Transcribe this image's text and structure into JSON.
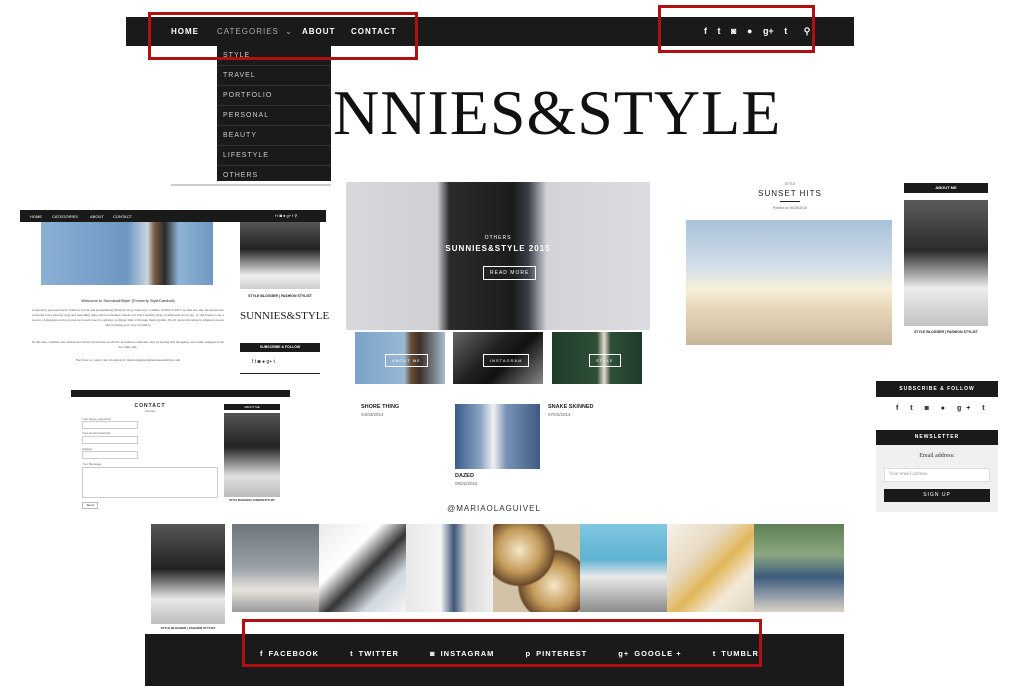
{
  "nav": {
    "home": "HOME",
    "categories": "CATEGORIES",
    "about": "ABOUT",
    "contact": "CONTACT",
    "chevron": "chevron-down-icon"
  },
  "dropdown": [
    "STYLE",
    "TRAVEL",
    "PORTFOLIO",
    "PERSONAL",
    "BEAUTY",
    "LIFESTYLE",
    "OTHERS"
  ],
  "social_icons": [
    "f",
    "t",
    "i",
    "p",
    "g+",
    "t"
  ],
  "logo_text": "NNIES&STYLE",
  "hero": {
    "category": "OTHERS",
    "title": "SUNNIES&STYLE 2015",
    "button": "READ MORE"
  },
  "tiles": [
    "ABOUT ME",
    "INSTAGRAM",
    "STYLE"
  ],
  "posts": [
    {
      "title": "SHORE THING",
      "date": "04/03/2014"
    },
    {
      "title": "SNAKE SKINNED",
      "date": "07/01/2014"
    },
    {
      "title": "DAZED",
      "date": "08/22/2015"
    }
  ],
  "instagram_handle": "@MARIAOLAGUIVEL",
  "right_post": {
    "category": "STYLE",
    "title": "SUNSET HITS",
    "date": "Posted on 05/25/2015"
  },
  "sidebar": {
    "about_title": "ABOUT ME",
    "caption": "STYLE BLOGGER | FASHION STYLIST",
    "subscribe_title": "SUBSCRIBE & FOLLOW",
    "newsletter_title": "NEWSLETTER",
    "email_label": "Email address:",
    "email_placeholder": "Your email address",
    "signup": "SIGN UP"
  },
  "mini_left": {
    "nav": [
      "HOME",
      "CATEGORIES",
      "ABOUT",
      "CONTACT"
    ],
    "welcome": "Welcome to Sunnies&Style! (Formerly StyleCarnival)",
    "para1": "A (mostly) personal style, fashion, travel and (sometimes) lifestyle blog created by Camille in March 2015. In this site she chronicles her personal fears (mostly not) and matching lines and non-fashion trends as I don't usually shop on high-end stores (ie, 1) and hopes to be a source of inspiration that everyone doesn't need to splurge on things that will make them stylish. It's all about investing in timeless pieces and working your way around it.",
    "para2": "In this site, Camille also shares her travel adventures, portfolio in fashion editorials, tips in styling and shopping, and some snippets from her daily life.",
    "para3": "Feel free to contact me via email at: mariaolaguivel@sunniesandstyle.com",
    "logo": "SUNNIES&STYLE",
    "caption": "STYLE BLOGGER | FASHION STYLIST",
    "subscribe": "SUBSCRIBE & FOLLOW"
  },
  "contact_mini": {
    "title": "CONTACT",
    "sub": "Contact",
    "fields": [
      "Your Name (required)",
      "Your Email (required)",
      "Subject",
      "Your Message"
    ],
    "send": "Send",
    "about": "ABOUT ME",
    "caption": "STYLE BLOGGER | FASHION STYLIST"
  },
  "strip_caption": "STYLE BLOGGER | FASHION STYLIST",
  "footer": [
    {
      "icon": "facebook-icon",
      "glyph": "f",
      "label": "FACEBOOK"
    },
    {
      "icon": "twitter-icon",
      "glyph": "t",
      "label": "TWITTER"
    },
    {
      "icon": "instagram-icon",
      "glyph": "◙",
      "label": "INSTAGRAM"
    },
    {
      "icon": "pinterest-icon",
      "glyph": "p",
      "label": "PINTEREST"
    },
    {
      "icon": "google-plus-icon",
      "glyph": "g+",
      "label": "GOOGLE +"
    },
    {
      "icon": "tumblr-icon",
      "glyph": "t",
      "label": "TUMBLR"
    }
  ],
  "colors": {
    "dark": "#1a1a1a",
    "highlight": "#b10f10"
  }
}
